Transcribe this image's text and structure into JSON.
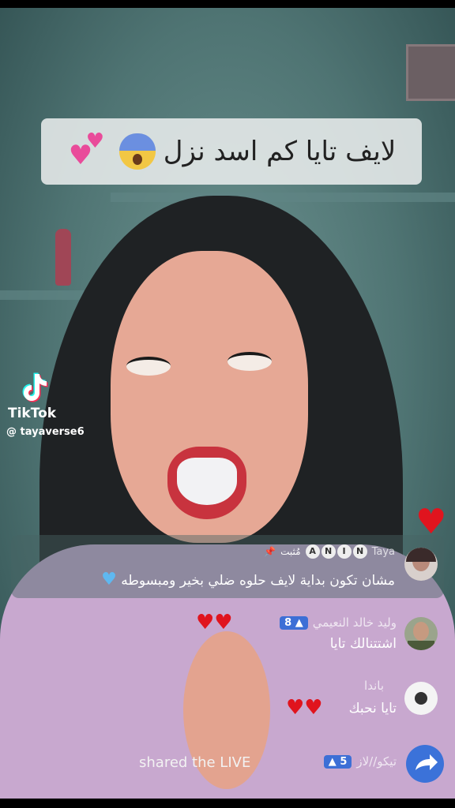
{
  "caption": {
    "text": "لايف تايا كم اسد نزل"
  },
  "watermark": {
    "brand": "TikTok",
    "handle": "@ tayaverse6"
  },
  "comments": [
    {
      "username": "Taya",
      "badge_letters": [
        "N",
        "I",
        "N",
        "A"
      ],
      "pinned_label": "مُثبت",
      "text": "مشان تكون بداية لايف حلوه ضلي بخير ومبسوطه"
    },
    {
      "username": "وليد خالد النعيمي",
      "level": "8",
      "text": "اشتتنالك تايا"
    },
    {
      "username": "باندا",
      "text": "تايا نحبك"
    }
  ],
  "activity": {
    "username": "تيكو//لاز",
    "level": "5",
    "text": "shared the LIVE"
  },
  "colors": {
    "accent": "#3d6fd6",
    "heart": "#e0141e"
  },
  "icons": [
    "tiktok-logo-icon",
    "pin-icon",
    "heart-icon",
    "share-arrow-icon"
  ]
}
